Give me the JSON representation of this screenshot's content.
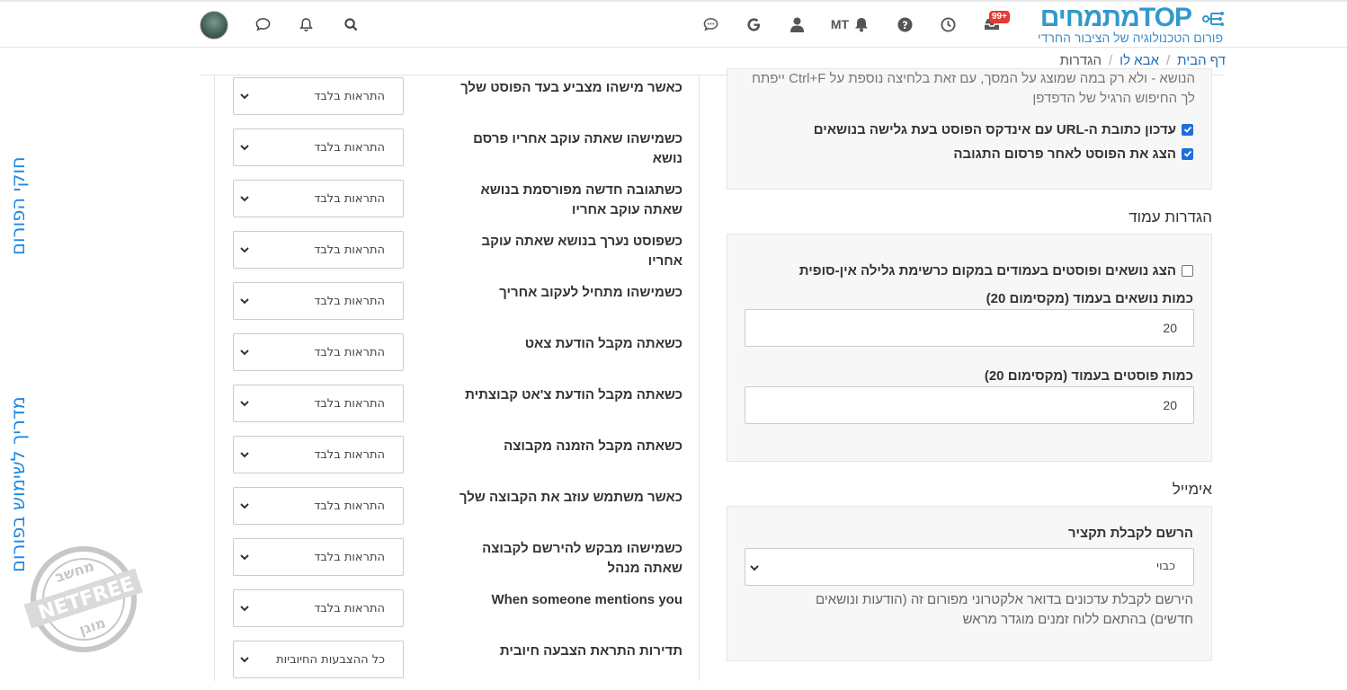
{
  "header": {
    "logo_main": "מתמחיםTOP",
    "logo_sub": "פורום הטכנולוגיה של הציבור החרדי",
    "inbox_badge": "99+",
    "user_initials": "MT",
    "icons": [
      "chat-icon",
      "google-icon",
      "user-icon",
      "bell-icon",
      "help-icon",
      "clock-icon",
      "inbox-icon",
      "search-icon",
      "notifications-icon",
      "chats-icon",
      "avatar"
    ]
  },
  "breadcrumb": {
    "home": "דף הבית",
    "user": "אבא לו",
    "current": "הגדרות",
    "sep": "/"
  },
  "side_links": {
    "rules": "חוקי הפורום",
    "guide": "מדריך לשימוש בפורום"
  },
  "notifications": [
    {
      "label": "כאשר מישהו מצביע בעד הפוסט שלך",
      "value": "התראות בלבד"
    },
    {
      "label": "כשמישהו שאתה עוקב אחריו פרסם נושא",
      "value": "התראות בלבד"
    },
    {
      "label": "כשתגובה חדשה מפורסמת בנושא שאתה עוקב אחריו",
      "value": "התראות בלבד"
    },
    {
      "label": "כשפוסט נערך בנושא שאתה עוקב אחריו",
      "value": "התראות בלבד"
    },
    {
      "label": "כשמישהו מתחיל לעקוב אחריך",
      "value": "התראות בלבד"
    },
    {
      "label": "כשאתה מקבל הודעת צאט",
      "value": "התראות בלבד"
    },
    {
      "label": "כשאתה מקבל הודעת צ'אט קבוצתית",
      "value": "התראות בלבד"
    },
    {
      "label": "כשאתה מקבל הזמנה מקבוצה",
      "value": "התראות בלבד"
    },
    {
      "label": "כאשר משתמש עוזב את הקבוצה שלך",
      "value": "התראות בלבד"
    },
    {
      "label": "כשמישהו מבקש להירשם לקבוצה שאתה מנהל",
      "value": "התראות בלבד"
    },
    {
      "label": "When someone mentions you",
      "value": "התראות בלבד"
    },
    {
      "label": "תדירות התראת הצבעה חיובית",
      "value": "כל ההצבעות החיוביות"
    }
  ],
  "top_card": {
    "help_text": "הנושא - ולא רק במה שמוצג על המסך, עם זאת בלחיצה נוספת על Ctrl+F ייפתח לך החיפוש הרגיל של הדפדפן",
    "chk1_label": "עדכון כתובת ה-URL עם אינדקס הפוסט בעת גלישה בנושאים",
    "chk1_checked": true,
    "chk2_label": "הצג את הפוסט לאחר פרסום התגובה",
    "chk2_checked": true
  },
  "page_settings": {
    "title": "הגדרות עמוד",
    "chk_label": "הצג נושאים ופוסטים בעמודים במקום כרשימת גלילה אין-סופית",
    "chk_checked": false,
    "topics_label": "כמות נושאים בעמוד (מקסימום 20)",
    "topics_value": "20",
    "posts_label": "כמות פוסטים בעמוד (מקסימום 20)",
    "posts_value": "20"
  },
  "email": {
    "title": "אימייל",
    "digest_label": "הרשם לקבלת תקציר",
    "digest_value": "כבוי",
    "digest_help": "הירשם לקבלת עדכונים בדואר אלקטרוני מפורום זה (הודעות ונושאים חדשים) בהתאם ללוח זמנים מוגדר מראש"
  },
  "watermark": {
    "top": "מחשב",
    "mid": "NETFREE",
    "bottom": "מוגן"
  },
  "colors": {
    "accent": "#1e88e5",
    "link": "#1e6fb8",
    "badge": "#e53935",
    "checkbox": "#1e6fd9"
  }
}
